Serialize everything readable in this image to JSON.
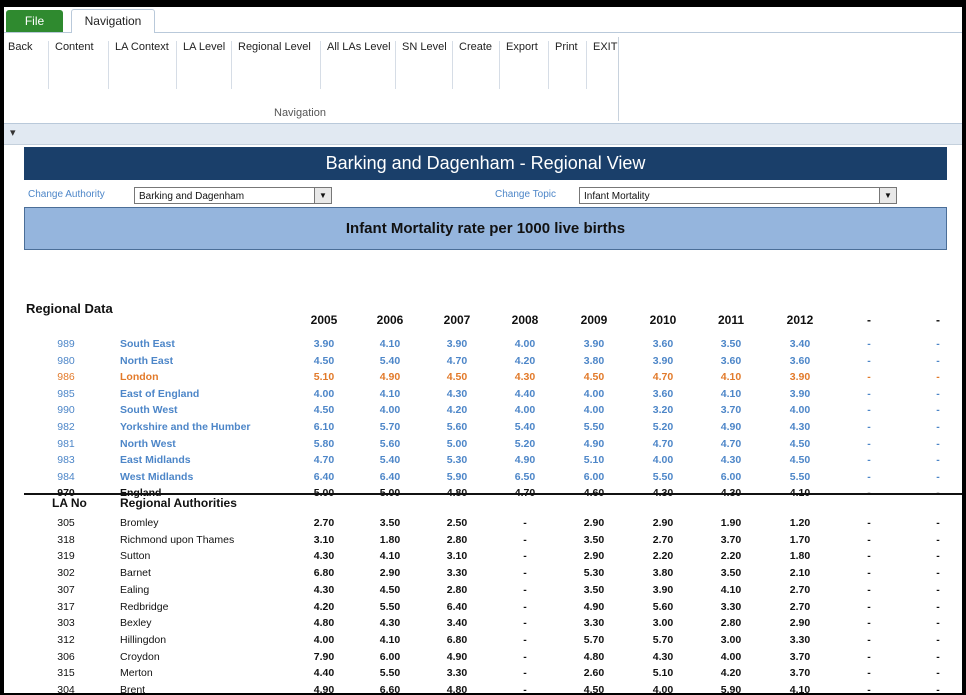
{
  "ribbon": {
    "tabs": [
      "File",
      "Navigation"
    ],
    "buttons": [
      "Back",
      "Content",
      "LA Context",
      "LA Level",
      "Regional Level",
      "All LAs Level",
      "SN Level",
      "Create",
      "Export",
      "Print",
      "EXIT"
    ],
    "group_label": "Navigation",
    "qa_icon": "▾"
  },
  "banner": "Barking and Dagenham  - Regional View",
  "controls": {
    "authority_label": "Change Authority",
    "authority_value": "Barking and Dagenham",
    "topic_label": "Change Topic",
    "topic_value": "Infant Mortality",
    "dropdown_arrow": "▼"
  },
  "subbanner": "Infant Mortality rate per 1000 live births",
  "section_title": "Regional Data",
  "years": [
    "2005",
    "2006",
    "2007",
    "2008",
    "2009",
    "2010",
    "2011",
    "2012",
    "-",
    "-"
  ],
  "regions": [
    {
      "no": "989",
      "name": "South East",
      "vals": [
        "3.90",
        "4.10",
        "3.90",
        "4.00",
        "3.90",
        "3.60",
        "3.50",
        "3.40",
        "-",
        "-"
      ],
      "style": "blue"
    },
    {
      "no": "980",
      "name": "North East",
      "vals": [
        "4.50",
        "5.40",
        "4.70",
        "4.20",
        "3.80",
        "3.90",
        "3.60",
        "3.60",
        "-",
        "-"
      ],
      "style": "blue"
    },
    {
      "no": "986",
      "name": "London",
      "vals": [
        "5.10",
        "4.90",
        "4.50",
        "4.30",
        "4.50",
        "4.70",
        "4.10",
        "3.90",
        "-",
        "-"
      ],
      "style": "orange"
    },
    {
      "no": "985",
      "name": "East of England",
      "vals": [
        "4.00",
        "4.10",
        "4.30",
        "4.40",
        "4.00",
        "3.60",
        "4.10",
        "3.90",
        "-",
        "-"
      ],
      "style": "blue"
    },
    {
      "no": "990",
      "name": "South West",
      "vals": [
        "4.50",
        "4.00",
        "4.20",
        "4.00",
        "4.00",
        "3.20",
        "3.70",
        "4.00",
        "-",
        "-"
      ],
      "style": "blue"
    },
    {
      "no": "982",
      "name": "Yorkshire and the Humber",
      "vals": [
        "6.10",
        "5.70",
        "5.60",
        "5.40",
        "5.50",
        "5.20",
        "4.90",
        "4.30",
        "-",
        "-"
      ],
      "style": "blue"
    },
    {
      "no": "981",
      "name": "North West",
      "vals": [
        "5.80",
        "5.60",
        "5.00",
        "5.20",
        "4.90",
        "4.70",
        "4.70",
        "4.50",
        "-",
        "-"
      ],
      "style": "blue"
    },
    {
      "no": "983",
      "name": "East Midlands",
      "vals": [
        "4.70",
        "5.40",
        "5.30",
        "4.90",
        "5.10",
        "4.00",
        "4.30",
        "4.50",
        "-",
        "-"
      ],
      "style": "blue"
    },
    {
      "no": "984",
      "name": "West Midlands",
      "vals": [
        "6.40",
        "6.40",
        "5.90",
        "6.50",
        "6.00",
        "5.50",
        "6.00",
        "5.50",
        "-",
        "-"
      ],
      "style": "blue"
    },
    {
      "no": "970",
      "name": "England",
      "vals": [
        "5.00",
        "5.00",
        "4.80",
        "4.70",
        "4.60",
        "4.30",
        "4.30",
        "4.10",
        "-",
        "-"
      ],
      "style": "black"
    }
  ],
  "la_header": {
    "no": "LA No",
    "name": "Regional Authorities"
  },
  "authorities": [
    {
      "no": "305",
      "name": "Bromley",
      "vals": [
        "2.70",
        "3.50",
        "2.50",
        "-",
        "2.90",
        "2.90",
        "1.90",
        "1.20",
        "-",
        "-"
      ]
    },
    {
      "no": "318",
      "name": "Richmond upon Thames",
      "vals": [
        "3.10",
        "1.80",
        "2.80",
        "-",
        "3.50",
        "2.70",
        "3.70",
        "1.70",
        "-",
        "-"
      ]
    },
    {
      "no": "319",
      "name": "Sutton",
      "vals": [
        "4.30",
        "4.10",
        "3.10",
        "-",
        "2.90",
        "2.20",
        "2.20",
        "1.80",
        "-",
        "-"
      ]
    },
    {
      "no": "302",
      "name": "Barnet",
      "vals": [
        "6.80",
        "2.90",
        "3.30",
        "-",
        "5.30",
        "3.80",
        "3.50",
        "2.10",
        "-",
        "-"
      ]
    },
    {
      "no": "307",
      "name": "Ealing",
      "vals": [
        "4.30",
        "4.50",
        "2.80",
        "-",
        "3.50",
        "3.90",
        "4.10",
        "2.70",
        "-",
        "-"
      ]
    },
    {
      "no": "317",
      "name": "Redbridge",
      "vals": [
        "4.20",
        "5.50",
        "6.40",
        "-",
        "4.90",
        "5.60",
        "3.30",
        "2.70",
        "-",
        "-"
      ]
    },
    {
      "no": "303",
      "name": "Bexley",
      "vals": [
        "4.80",
        "4.30",
        "3.40",
        "-",
        "3.30",
        "3.00",
        "2.80",
        "2.90",
        "-",
        "-"
      ]
    },
    {
      "no": "312",
      "name": "Hillingdon",
      "vals": [
        "4.00",
        "4.10",
        "6.80",
        "-",
        "5.70",
        "5.70",
        "3.00",
        "3.30",
        "-",
        "-"
      ]
    },
    {
      "no": "306",
      "name": "Croydon",
      "vals": [
        "7.90",
        "6.00",
        "4.90",
        "-",
        "4.80",
        "4.30",
        "4.00",
        "3.70",
        "-",
        "-"
      ]
    },
    {
      "no": "315",
      "name": "Merton",
      "vals": [
        "4.40",
        "5.50",
        "3.30",
        "-",
        "2.60",
        "5.10",
        "4.20",
        "3.70",
        "-",
        "-"
      ]
    },
    {
      "no": "304",
      "name": "Brent",
      "vals": [
        "4.90",
        "6.60",
        "4.80",
        "-",
        "4.50",
        "4.00",
        "5.90",
        "4.10",
        "-",
        "-"
      ]
    }
  ]
}
